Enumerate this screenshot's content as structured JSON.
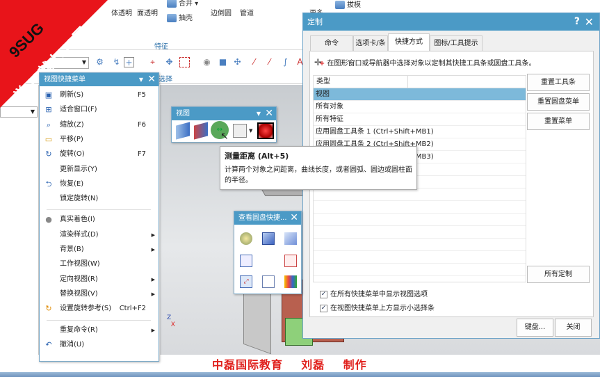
{
  "ribbon": {
    "items": [
      "体透明",
      "面透明",
      "合并",
      "抽壳",
      "边倒圆",
      "管道",
      "更多",
      "拔模"
    ],
    "group_label": "特征",
    "selection_label": "选择"
  },
  "watermark": {
    "line1": "9SUG",
    "line2": "学UG就上UG网",
    "credit": "中磊国际教育    刘磊    制作"
  },
  "context_menu": {
    "title": "视图快捷菜单",
    "items": [
      {
        "label": "刷新(S)",
        "shortcut": "F5",
        "icon": "refresh-icon"
      },
      {
        "label": "适合窗口(F)",
        "shortcut": "",
        "icon": "fit-window-icon"
      },
      {
        "label": "缩放(Z)",
        "shortcut": "F6",
        "icon": "zoom-icon"
      },
      {
        "label": "平移(P)",
        "shortcut": "",
        "icon": "pan-icon"
      },
      {
        "label": "旋转(O)",
        "shortcut": "F7",
        "icon": "rotate-icon"
      },
      {
        "label": "更新显示(Y)",
        "shortcut": ""
      },
      {
        "label": "恢复(E)",
        "shortcut": "",
        "icon": "restore-icon"
      },
      {
        "label": "锁定旋转(N)",
        "shortcut": ""
      },
      {
        "label": "真实着色(I)",
        "shortcut": "",
        "icon": "true-shading-icon"
      },
      {
        "label": "渲染样式(D)",
        "submenu": true
      },
      {
        "label": "背景(B)",
        "submenu": true
      },
      {
        "label": "工作视图(W)"
      },
      {
        "label": "定向视图(R)",
        "submenu": true
      },
      {
        "label": "替换视图(V)",
        "submenu": true
      },
      {
        "label": "设置旋转参考(S)",
        "shortcut": "Ctrl+F2",
        "icon": "rotate-reference-icon"
      },
      {
        "label": "重复命令(R)",
        "submenu": true
      },
      {
        "label": "撤消(U)",
        "icon": "undo-icon"
      }
    ]
  },
  "view_toolbar": {
    "title": "视图"
  },
  "tooltip": {
    "title": "测量距离 (Alt+5)",
    "desc": "计算两个对象之间距离，曲线长度，或者圆弧、圆边或圆柱面的半径。"
  },
  "radial_toolbar": {
    "title": "查看圆盘快捷..."
  },
  "dialog": {
    "title": "定制",
    "help": "?",
    "tabs": [
      "命令",
      "选项卡/条",
      "快捷方式",
      "图标/工具提示"
    ],
    "active_tab": 2,
    "info": "在图形窗口或导航器中选择对象以定制其快捷工具条或圆盘工具条。",
    "list_header": "类型",
    "rows": [
      "视图",
      "所有对象",
      "所有特征",
      "应用圆盘工具条 1 (Ctrl+Shift+MB1)",
      "应用圆盘工具条 2 (Ctrl+Shift+MB2)",
      "应用圆盘工具条 3 (Ctrl+Shift+MB3)"
    ],
    "selected_row": 0,
    "buttons": {
      "reset_toolbar": "重置工具条",
      "reset_radial": "重置圆盘菜单",
      "reset_menu": "重置菜单",
      "all_custom": "所有定制",
      "keyboard": "键盘...",
      "close": "关闭"
    },
    "checkboxes": [
      {
        "label": "在所有快捷菜单中显示视图选项",
        "checked": true
      },
      {
        "label": "在视图快捷菜单上方显示小选择条",
        "checked": true
      }
    ]
  },
  "colors": {
    "title_bar": "#4b9ac6",
    "selected_row": "#7db9da",
    "watermark_red": "#e8141a"
  }
}
